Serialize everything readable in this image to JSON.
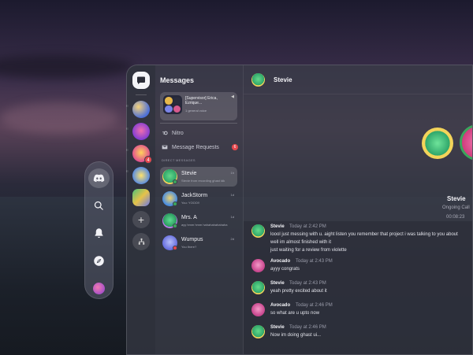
{
  "colors": {
    "accent": "#5865f2",
    "online": "#3ba55c",
    "danger": "#e5484d",
    "stevie_green": "#2fa66a",
    "pink": "#e0569a"
  },
  "dock": {
    "items": [
      {
        "icon": "discord-icon"
      },
      {
        "icon": "search-icon"
      },
      {
        "icon": "bell-icon"
      },
      {
        "icon": "compass-icon"
      },
      {
        "icon": "avatar-icon"
      }
    ]
  },
  "rail": {
    "badge_count": "4"
  },
  "dm_list": {
    "title": "Messages",
    "group": {
      "name": "[Supervisor] Erica, Ezrique...",
      "sub": "1 general voice"
    },
    "nitro_label": "Nitro",
    "requests_label": "Message Requests",
    "requests_count": "6",
    "section_label": "DIRECT MESSAGES",
    "items": [
      {
        "name": "Stevie",
        "preview": "Stevie from recording ghast idk",
        "time": "1h",
        "status": "online"
      },
      {
        "name": "JackStorm",
        "preview": "You: YOOO!!",
        "time": "1d",
        "status": "online"
      },
      {
        "name": "Mrs. A",
        "preview": "ayy hmm hmm hahahahahahaha",
        "time": "1d",
        "status": "online"
      },
      {
        "name": "Wumpus",
        "preview": "You there?",
        "time": "2d",
        "status": "dnd"
      }
    ]
  },
  "chat": {
    "header_name": "Stevie",
    "call": {
      "name": "Stevie",
      "status": "Ongoing Call",
      "duration": "00:08:23"
    },
    "messages": [
      {
        "author": "Stevie",
        "time": "Today at 2:42 PM",
        "lines": [
          "loool just messing with u. aight listen you remember that project i was talking to you about",
          "well im almost finished with it",
          "just waiting for a review from violette"
        ]
      },
      {
        "author": "Avocado",
        "time": "Today at 2:43 PM",
        "lines": [
          "ayyy congrats"
        ]
      },
      {
        "author": "Stevie",
        "time": "Today at 2:43 PM",
        "lines": [
          "yeah pretty excited about it"
        ]
      },
      {
        "author": "Avocado",
        "time": "Today at 2:46 PM",
        "lines": [
          "so what are u upto now"
        ]
      },
      {
        "author": "Stevie",
        "time": "Today at 2:46 PM",
        "lines": [
          "Now im doing ghast ui..."
        ]
      }
    ]
  }
}
